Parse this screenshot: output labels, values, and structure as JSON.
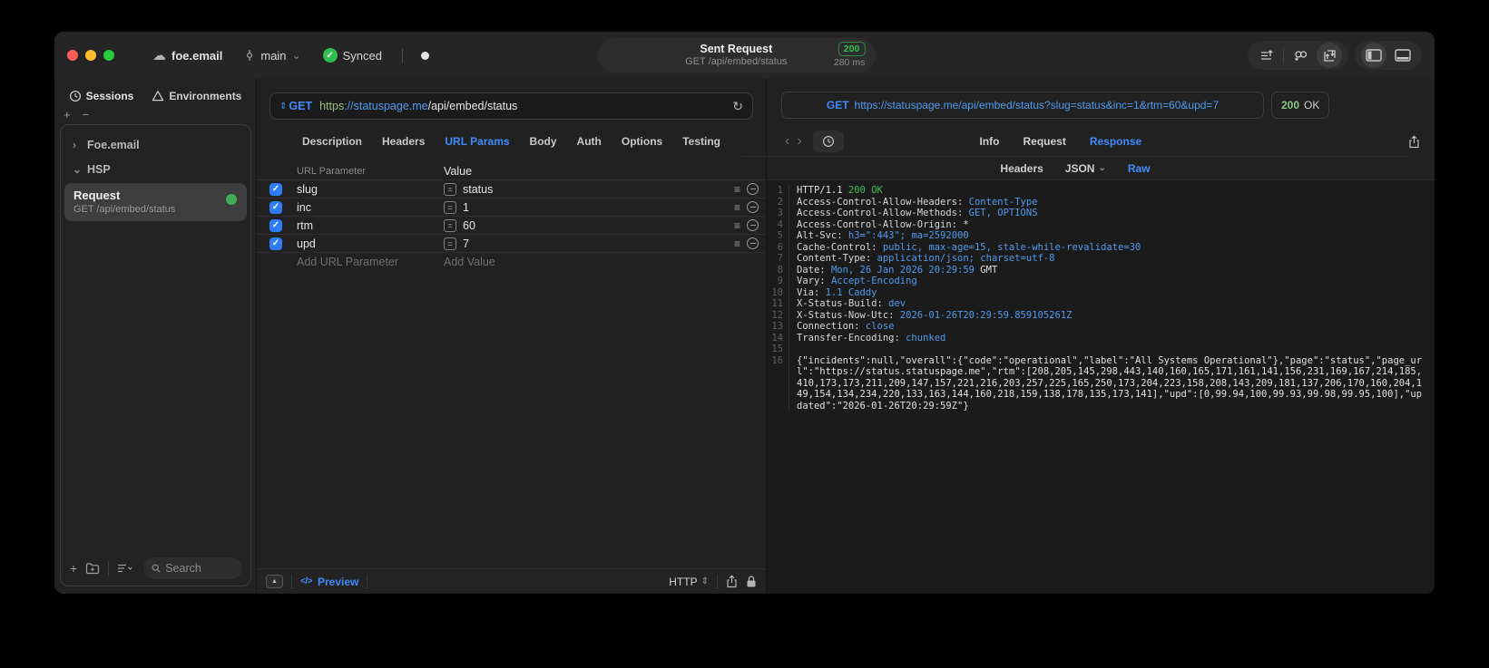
{
  "window": {
    "project": "foe.email",
    "branch": "main",
    "sync_status": "Synced",
    "title": "Sent Request",
    "subtitle": "GET /api/embed/status",
    "status_code": "200",
    "duration": "280 ms"
  },
  "icons": {
    "cloud": "☁",
    "check": "✓",
    "chevron_down": "⌄",
    "chevron_right": "›",
    "back": "‹",
    "forward": "›",
    "plus": "+",
    "minus": "−",
    "reload": "↻",
    "equals": "=",
    "reorder": "≡",
    "collapse": "▲",
    "code_glyph": "</>",
    "updown": "⇕"
  },
  "sidebar": {
    "tabs": [
      {
        "label": "Sessions"
      },
      {
        "label": "Environments"
      }
    ],
    "tree": [
      {
        "label": "Foe.email"
      },
      {
        "label": "HSP"
      }
    ],
    "request_item": {
      "title": "Request",
      "subtitle": "GET /api/embed/status"
    },
    "search_placeholder": "Search"
  },
  "request": {
    "method": "GET",
    "url_scheme": "https",
    "url_host": "://statuspage.me",
    "url_path": "/api/embed/status",
    "tabs": [
      "Description",
      "Headers",
      "URL Params",
      "Body",
      "Auth",
      "Options",
      "Testing"
    ],
    "active_tab": "URL Params",
    "params": {
      "col_name": "URL Parameter",
      "col_value": "Value",
      "rows": [
        {
          "name": "slug",
          "value": "status"
        },
        {
          "name": "inc",
          "value": "1"
        },
        {
          "name": "rtm",
          "value": "60"
        },
        {
          "name": "upd",
          "value": "7"
        }
      ],
      "add_name": "Add URL Parameter",
      "add_value": "Add Value"
    },
    "footer": {
      "preview": "Preview",
      "protocol": "HTTP"
    }
  },
  "response": {
    "method": "GET",
    "url": "https://statuspage.me/api/embed/status?slug=status&inc=1&rtm=60&upd=7",
    "status_code": "200",
    "status_text": "OK",
    "tabs": [
      "Info",
      "Request",
      "Response"
    ],
    "active_tab": "Response",
    "subtabs": [
      "Headers",
      "JSON",
      "Raw"
    ],
    "active_subtab": "Raw",
    "lines": [
      {
        "n": 1,
        "parts": [
          {
            "t": "HTTP/1.1 ",
            "c": "p"
          },
          {
            "t": "200 OK",
            "c": "g"
          }
        ]
      },
      {
        "n": 2,
        "parts": [
          {
            "t": "Access-Control-Allow-Headers: ",
            "c": "n"
          },
          {
            "t": "Content-Type",
            "c": "b"
          }
        ]
      },
      {
        "n": 3,
        "parts": [
          {
            "t": "Access-Control-Allow-Methods: ",
            "c": "n"
          },
          {
            "t": "GET, OPTIONS",
            "c": "b"
          }
        ]
      },
      {
        "n": 4,
        "parts": [
          {
            "t": "Access-Control-Allow-Origin: ",
            "c": "n"
          },
          {
            "t": "*",
            "c": "p"
          }
        ]
      },
      {
        "n": 5,
        "parts": [
          {
            "t": "Alt-Svc: ",
            "c": "n"
          },
          {
            "t": "h3=\":443\"; ma=2592000",
            "c": "b"
          }
        ]
      },
      {
        "n": 6,
        "parts": [
          {
            "t": "Cache-Control: ",
            "c": "n"
          },
          {
            "t": "public, max-age=15, stale-while-revalidate=30",
            "c": "b"
          }
        ]
      },
      {
        "n": 7,
        "parts": [
          {
            "t": "Content-Type: ",
            "c": "n"
          },
          {
            "t": "application/json; charset=utf-8",
            "c": "b"
          }
        ]
      },
      {
        "n": 8,
        "parts": [
          {
            "t": "Date: ",
            "c": "n"
          },
          {
            "t": "Mon, 26 Jan 2026 20:29:59",
            "c": "b"
          },
          {
            "t": " GMT",
            "c": "p"
          }
        ]
      },
      {
        "n": 9,
        "parts": [
          {
            "t": "Vary: ",
            "c": "n"
          },
          {
            "t": "Accept-Encoding",
            "c": "b"
          }
        ]
      },
      {
        "n": 10,
        "parts": [
          {
            "t": "Via: ",
            "c": "n"
          },
          {
            "t": "1.1 Caddy",
            "c": "b"
          }
        ]
      },
      {
        "n": 11,
        "parts": [
          {
            "t": "X-Status-Build: ",
            "c": "n"
          },
          {
            "t": "dev",
            "c": "b"
          }
        ]
      },
      {
        "n": 12,
        "parts": [
          {
            "t": "X-Status-Now-Utc: ",
            "c": "n"
          },
          {
            "t": "2026-01-26T20:29:59.859105261Z",
            "c": "b"
          }
        ]
      },
      {
        "n": 13,
        "parts": [
          {
            "t": "Connection: ",
            "c": "n"
          },
          {
            "t": "close",
            "c": "b"
          }
        ]
      },
      {
        "n": 14,
        "parts": [
          {
            "t": "Transfer-Encoding: ",
            "c": "n"
          },
          {
            "t": "chunked",
            "c": "b"
          }
        ]
      },
      {
        "n": 15,
        "parts": []
      },
      {
        "n": 16,
        "parts": [
          {
            "t": "{\"incidents\":null,\"overall\":{\"code\":\"operational\",\"label\":\"All Systems Operational\"},\"page\":\"status\",\"page_url\":\"https://status.statuspage.me\",\"rtm\":[208,205,145,298,443,140,160,165,171,161,141,156,231,169,167,214,185,410,173,173,211,209,147,157,221,216,203,257,225,165,250,173,204,223,158,208,143,209,181,137,206,170,160,204,149,154,134,234,220,133,163,144,160,218,159,138,178,135,173,141],\"upd\":[0,99.94,100,99.93,99.98,99.95,100],\"updated\":\"2026-01-26T20:29:59Z\"}",
            "c": "p"
          }
        ]
      }
    ]
  },
  "colors": {
    "accent_blue": "#3f8cff",
    "code_blue": "#4f9cf0",
    "green": "#36c04d",
    "window_bg": "#222222",
    "code_bg": "#1b1b1b"
  }
}
